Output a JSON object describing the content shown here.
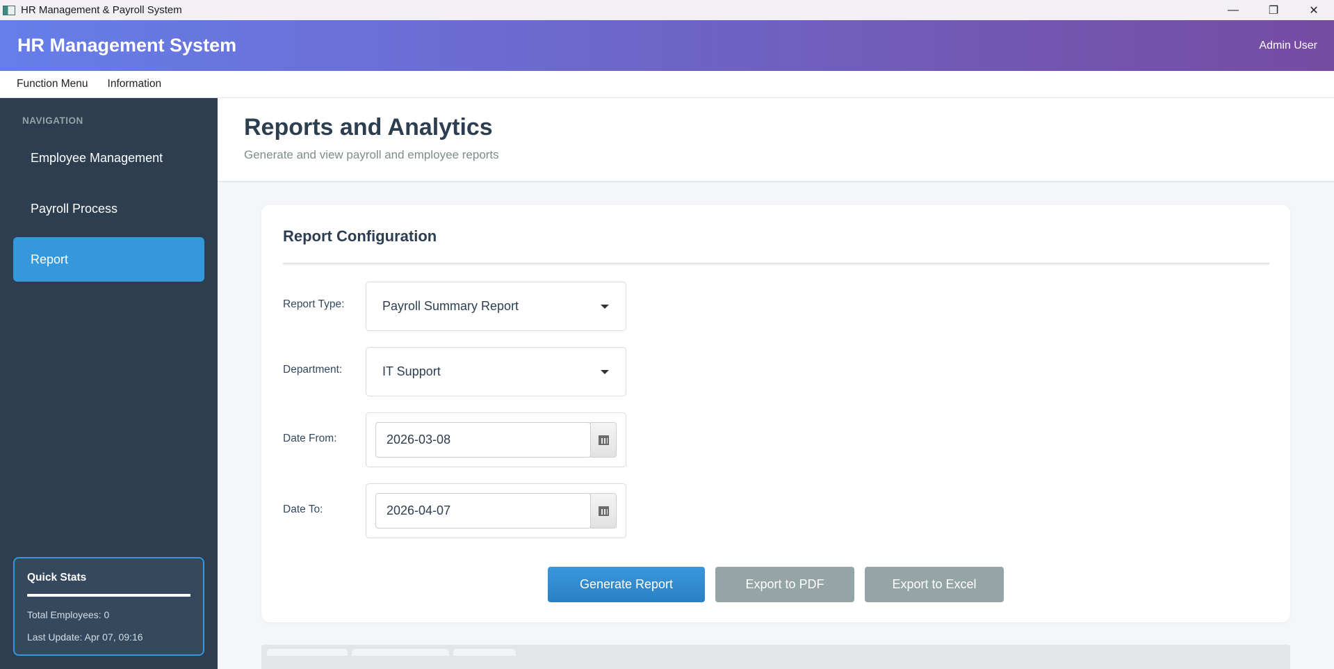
{
  "window": {
    "title": "HR Management & Payroll System",
    "minimize": "—",
    "restore": "❐",
    "close": "✕"
  },
  "header": {
    "app_title": "HR Management System",
    "user": "Admin User"
  },
  "menubar": {
    "items": [
      "Function Menu",
      "Information"
    ]
  },
  "sidebar": {
    "section_label": "NAVIGATION",
    "items": [
      {
        "label": "Employee Management",
        "active": false
      },
      {
        "label": "Payroll Process",
        "active": false
      },
      {
        "label": "Report",
        "active": true
      }
    ],
    "quick_stats": {
      "title": "Quick Stats",
      "total_employees": "Total Employees: 0",
      "last_update": "Last Update: Apr 07, 09:16"
    }
  },
  "page": {
    "title": "Reports and Analytics",
    "subtitle": "Generate and view payroll and employee reports"
  },
  "report_config": {
    "title": "Report Configuration",
    "report_type": {
      "label": "Report Type:",
      "value": "Payroll Summary Report"
    },
    "department": {
      "label": "Department:",
      "value": "IT Support"
    },
    "date_from": {
      "label": "Date From:",
      "value": "2026-03-08"
    },
    "date_to": {
      "label": "Date To:",
      "value": "2026-04-07"
    },
    "buttons": {
      "generate": "Generate Report",
      "export_pdf": "Export to PDF",
      "export_excel": "Export to Excel"
    }
  },
  "colors": {
    "header_gradient_start": "#667eea",
    "header_gradient_end": "#764ba2",
    "sidebar_bg": "#2c3e50",
    "accent": "#3498db",
    "secondary_button": "#95a5a6"
  }
}
